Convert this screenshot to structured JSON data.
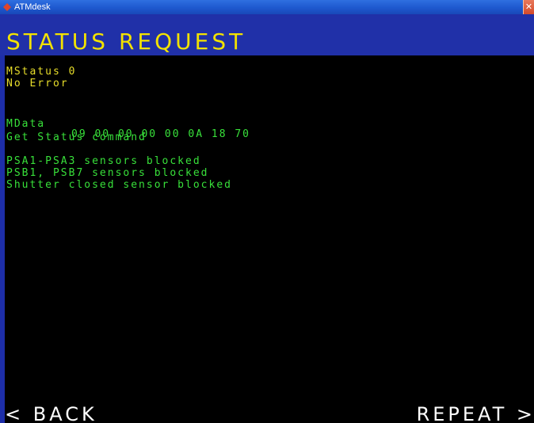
{
  "window": {
    "title": "ATMdesk",
    "close_glyph": "✕"
  },
  "header": {
    "title": "STATUS REQUEST"
  },
  "status": {
    "mstatus": "MStatus 0",
    "error": "No Error"
  },
  "mdata": {
    "label": "MData",
    "value": "09 00 00 00 00 0A 18 70"
  },
  "command": "Get Status command",
  "messages": [
    "PSA1-PSA3 sensors blocked",
    "PSB1, PSB7 sensors blocked",
    "Shutter closed sensor blocked"
  ],
  "footer": {
    "back_label": "< BACK",
    "repeat_label": "REPEAT >"
  },
  "colors": {
    "header_bg": "#2030a8",
    "header_text": "#f2e200",
    "status_text": "#e8de2a",
    "data_text": "#38e03a",
    "background": "#000000"
  }
}
